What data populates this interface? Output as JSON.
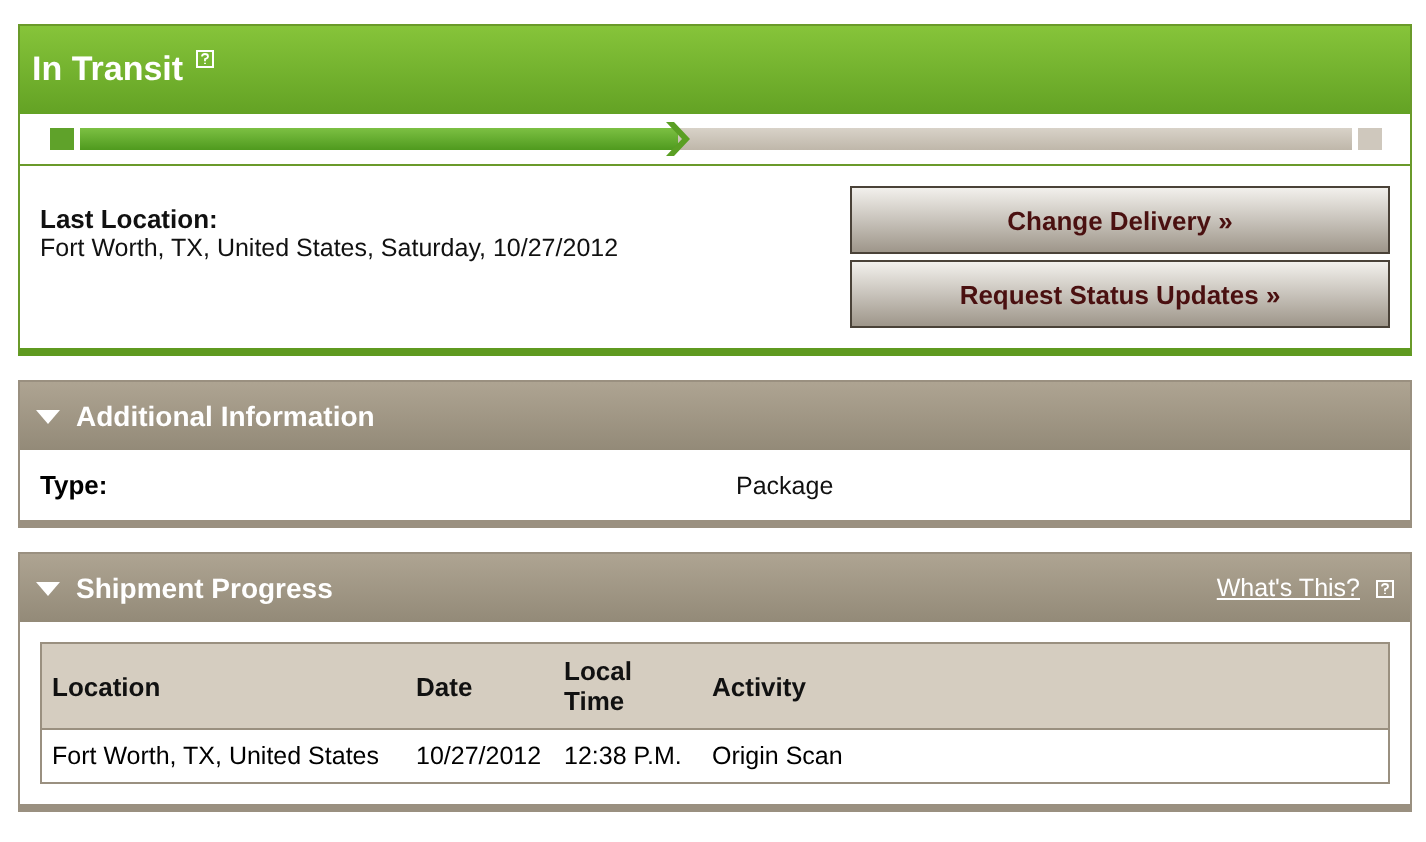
{
  "status": {
    "title": "In Transit",
    "progress": {
      "level": 0.47
    },
    "last_location_label": "Last Location:",
    "last_location": "Fort Worth, TX, United States, Saturday, 10/27/2012",
    "buttons": [
      "Change Delivery »",
      "Request Status Updates »"
    ]
  },
  "additional_information": {
    "title": "Additional Information",
    "expanded": true,
    "rows": [
      {
        "label": "Type:",
        "value": "Package"
      }
    ]
  },
  "shipment_progress": {
    "title": "Shipment Progress",
    "expanded": true,
    "help_link": "What's This?",
    "table": {
      "columns": [
        "Location",
        "Date",
        "Local Time",
        "Activity"
      ],
      "rows": [
        [
          "Fort Worth, TX, United States",
          "10/27/2012",
          "12:38 P.M.",
          "Origin Scan"
        ]
      ]
    }
  }
}
